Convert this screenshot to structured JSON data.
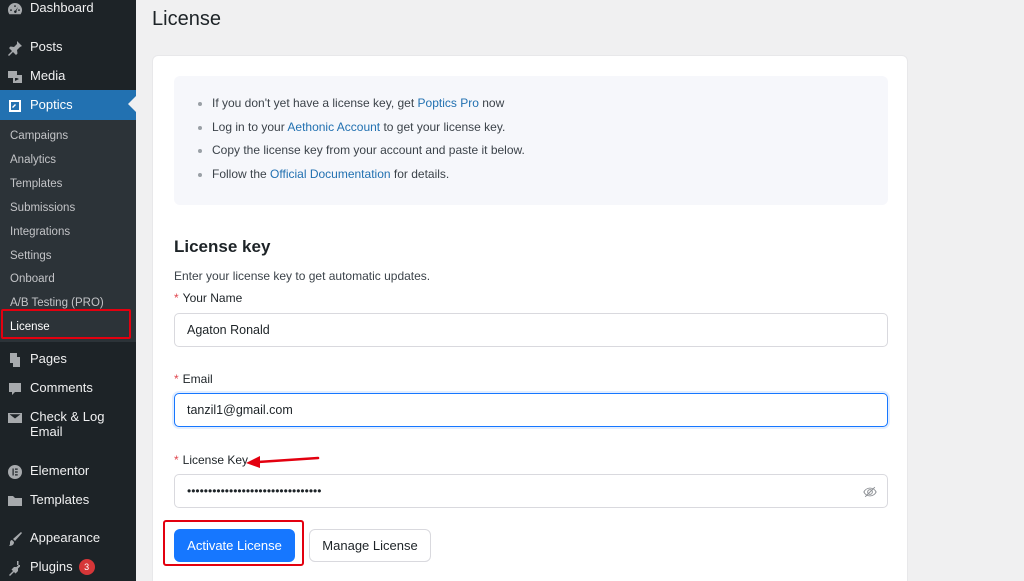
{
  "sidebar": {
    "items_top": [
      {
        "label": "Dashboard",
        "icon": "dashboard-icon"
      },
      {
        "label": "Posts",
        "icon": "pin-icon"
      },
      {
        "label": "Media",
        "icon": "media-icon"
      },
      {
        "label": "Poptics",
        "icon": "poptics-icon"
      }
    ],
    "submenu": [
      {
        "label": "Campaigns"
      },
      {
        "label": "Analytics"
      },
      {
        "label": "Templates"
      },
      {
        "label": "Submissions"
      },
      {
        "label": "Integrations"
      },
      {
        "label": "Settings"
      },
      {
        "label": "Onboard"
      },
      {
        "label": "A/B Testing (PRO)"
      },
      {
        "label": "License"
      }
    ],
    "items_bottom": [
      {
        "label": "Pages",
        "icon": "pages-icon"
      },
      {
        "label": "Comments",
        "icon": "comments-icon"
      },
      {
        "label": "Check & Log",
        "label2": "Email",
        "icon": "email-icon"
      },
      {
        "label": "Elementor",
        "icon": "elementor-icon"
      },
      {
        "label": "Templates",
        "icon": "folder-icon"
      },
      {
        "label": "Appearance",
        "icon": "brush-icon"
      },
      {
        "label": "Plugins",
        "icon": "plugin-icon",
        "badge": "3"
      }
    ],
    "accent_color": "#2271b1"
  },
  "page": {
    "title": "License"
  },
  "info": {
    "line1_pre": "If you don't yet have a license key, get ",
    "line1_link": "Poptics Pro",
    "line1_post": " now",
    "line2_pre": "Log in to your ",
    "line2_link": "Aethonic Account",
    "line2_post": " to get your license key.",
    "line3": "Copy the license key from your account and paste it below.",
    "line4_pre": "Follow the ",
    "line4_link": "Official Documentation",
    "line4_post": " for details."
  },
  "form": {
    "section_title": "License key",
    "description": "Enter your license key to get automatic updates.",
    "required_mark": "*",
    "name_label": "Your Name",
    "name_value": "Agaton Ronald",
    "email_label": "Email",
    "email_value": "tanzil1@gmail.com",
    "key_label": "License Key",
    "key_value_masked": "••••••••••••••••••••••••••••••••",
    "activate_label": "Activate License",
    "manage_label": "Manage License",
    "primary_color": "#1677ff",
    "highlight_color": "#e3000f"
  }
}
